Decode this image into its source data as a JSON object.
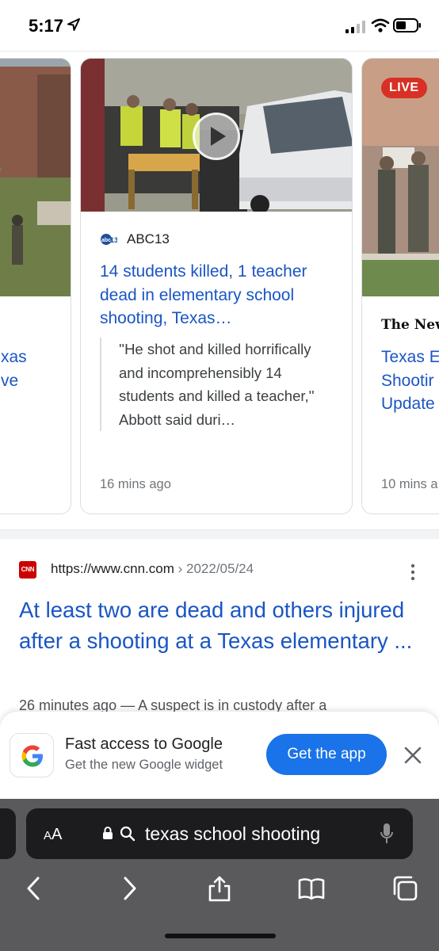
{
  "status_bar": {
    "time": "5:17"
  },
  "carousel": {
    "left_card": {
      "headline": "xas\nve"
    },
    "mid_card": {
      "source": "ABC13",
      "headline": "14 students killed, 1 teacher dead in elementary school shooting, Texas…",
      "quote": "''He shot and killed horrifically and incomprehensibly 14 students and killed a teacher,'' Abbott said duri…",
      "timestamp": "16 mins ago"
    },
    "right_card": {
      "badge": "LIVE",
      "source": "The New Y",
      "headline": "Texas E\nShootir\nUpdate",
      "timestamp": "10 mins a"
    }
  },
  "result": {
    "logo_text": "CNN",
    "url": "https://www.cnn.com",
    "date": " › 2022/05/24",
    "title": "At least two are dead and others injured after a shooting at a Texas elementary ...",
    "snippet": "26 minutes ago — A suspect is in custody after a"
  },
  "promo": {
    "title": "Fast access to Google",
    "subtitle": "Get the new Google widget",
    "button": "Get the app"
  },
  "browser": {
    "aa_big": "A",
    "aa_small": "A",
    "address": "texas school shooting"
  },
  "colors": {
    "link": "#1a55c4",
    "live_badge": "#d93025",
    "primary_button": "#1a73e8",
    "toolbar": "#5a5a5c"
  },
  "icons": [
    "location-arrow-icon",
    "signal-icon",
    "wifi-icon",
    "battery-icon",
    "play-icon",
    "more-vert-icon",
    "google-g-icon",
    "close-icon",
    "lock-icon",
    "search-icon",
    "mic-icon",
    "back-icon",
    "forward-icon",
    "share-icon",
    "bookmarks-icon",
    "tabs-icon"
  ]
}
